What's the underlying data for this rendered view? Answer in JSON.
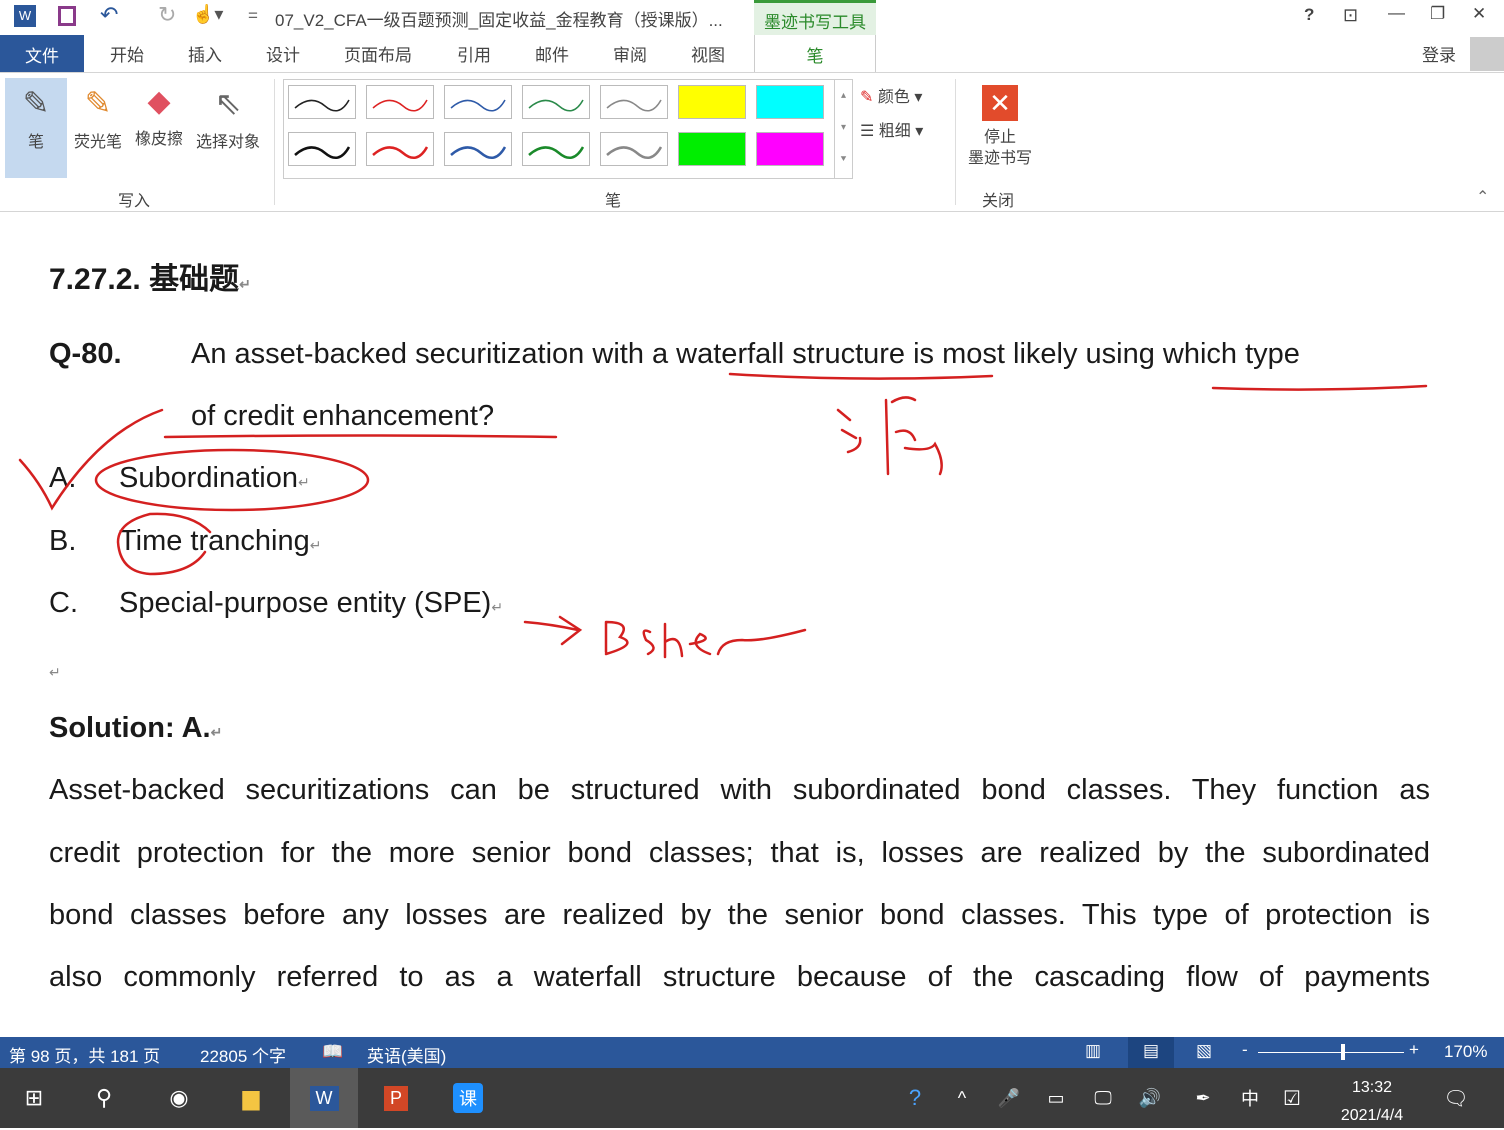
{
  "titlebar": {
    "title": "07_V2_CFA一级百题预测_固定收益_金程教育（授课版）...",
    "context_tab": "墨迹书写工具",
    "help": "?",
    "controls": [
      "—",
      "❐",
      "✕"
    ]
  },
  "tabs": {
    "file": "文件",
    "items": [
      "开始",
      "插入",
      "设计",
      "页面布局",
      "引用",
      "邮件",
      "审阅",
      "视图"
    ],
    "active": "笔",
    "login": "登录"
  },
  "ribbon": {
    "write_group": "写入",
    "tools": [
      "笔",
      "荧光笔",
      "橡皮擦",
      "选择对象"
    ],
    "pens_group": "笔",
    "color": "颜色",
    "thickness": "粗细",
    "stop_label": "停止\n墨迹书写",
    "close_group": "关闭",
    "pen_colors": [
      "#222",
      "#d22",
      "#2e5aa8",
      "#2a8a4a",
      "#888",
      "#ffff00",
      "#00ffff",
      "#111",
      "#d22",
      "#2e5aa8",
      "#1a8a2a",
      "#888",
      "#00ee00",
      "#ff00ff"
    ]
  },
  "doc": {
    "heading_num": "7.27.2.",
    "heading_text": "基础题",
    "q_label": "Q-80.",
    "q_line1": "An asset-backed securitization with a waterfall structure is most likely using which type",
    "q_line2": "of credit enhancement?",
    "options": [
      {
        "letter": "A.",
        "text": "Subordination"
      },
      {
        "letter": "B.",
        "text": "Time tranching"
      },
      {
        "letter": "C.",
        "text": "Special-purpose entity (SPE)"
      }
    ],
    "solution": "Solution: A.",
    "para": [
      "Asset-backed securitizations can be structured with subordinated bond classes. They function as",
      "credit protection for the more senior bond classes; that is, losses are realized by the subordinated",
      "bond classes before any losses are realized by the senior bond classes. This type of protection is",
      "also commonly referred to as a waterfall structure because of the cascading flow of payments"
    ]
  },
  "status": {
    "page": "第 98 页，共 181 页",
    "words": "22805 个字",
    "lang": "英语(美国)",
    "zoom": "170%"
  },
  "taskbar": {
    "time": "13:32",
    "date": "2021/4/4",
    "ime": "中"
  }
}
